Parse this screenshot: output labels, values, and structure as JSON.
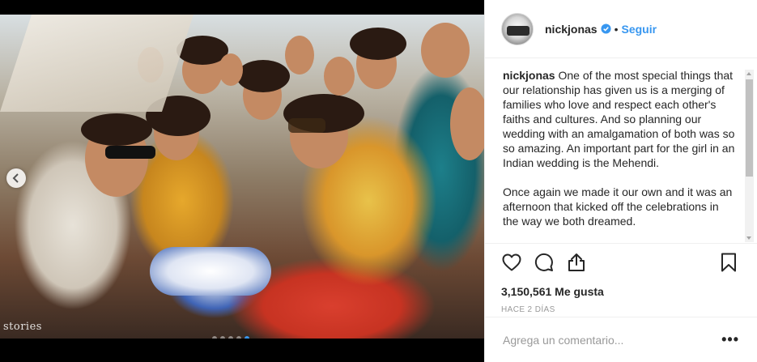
{
  "post": {
    "username": "nickjonas",
    "follow_label": "Seguir",
    "separator": "•",
    "caption_text": " One of the most special things that our relationship has given us is a merging of families who love and respect each other's faiths and cultures. And so planning our wedding with an amalgamation of both was so so amazing. An important part for the girl in an Indian wedding is the Mehendi.\n\nOnce again we made it our own and it was an afternoon that kicked off the celebrations in the way we both dreamed.",
    "likes": "3,150,561 Me gusta",
    "time": "HACE 2 DÍAS",
    "comment_placeholder": "Agrega un comentario...",
    "more_label": "•••"
  },
  "photo": {
    "watermark": "stories",
    "carousel_dots": 5,
    "active_dot": 4
  },
  "icons": {
    "like": "heart-icon",
    "comment": "comment-icon",
    "share": "share-icon",
    "save": "bookmark-icon",
    "verified": "verified-badge-icon",
    "prev": "chevron-left-icon"
  },
  "colors": {
    "link_blue": "#3897f0",
    "text": "#262626",
    "muted": "#999999"
  }
}
